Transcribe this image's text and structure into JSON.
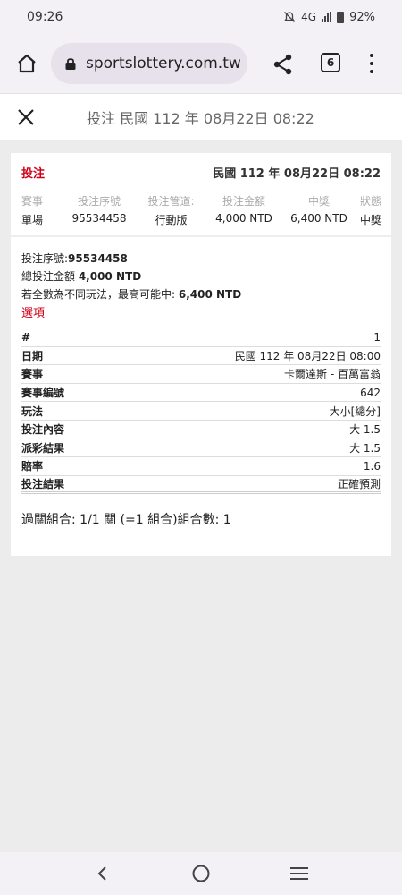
{
  "status": {
    "time": "09:26",
    "network": "4G",
    "battery": "92%"
  },
  "browser": {
    "url": "sportslottery.com.tw",
    "tab_count": "6"
  },
  "header": {
    "title": "投注 民國 112 年 08月22日 08:22"
  },
  "card": {
    "bet_label": "投注",
    "bet_date": "民國 112 年 08月22日 08:22",
    "headers": [
      "賽事",
      "投注序號",
      "投注管道:",
      "投注金額",
      "中獎",
      "狀態"
    ],
    "values": [
      "單場",
      "95534458",
      "行動版",
      "4,000 NTD",
      "6,400 NTD",
      "中獎"
    ],
    "serial_label": "投注序號:",
    "serial_value": "95534458",
    "total_label": "總投注金額 ",
    "total_value": "4,000 NTD",
    "max_label": "若全數為不同玩法，最高可能中: ",
    "max_value": "6,400 NTD",
    "options_label": "選項",
    "rows": [
      {
        "k": "#",
        "v": "1"
      },
      {
        "k": "日期",
        "v": "民國 112 年 08月22日 08:00"
      },
      {
        "k": "賽事",
        "v": "卡爾達斯 - 百萬富翁"
      },
      {
        "k": "賽事編號",
        "v": "642"
      },
      {
        "k": "玩法",
        "v": "大小[總分]"
      },
      {
        "k": "投注內容",
        "v": "大 1.5"
      },
      {
        "k": "派彩結果",
        "v": "大 1.5"
      },
      {
        "k": "賠率",
        "v": "1.6"
      },
      {
        "k": "投注結果",
        "v": "正確預測"
      }
    ],
    "combo": "過關組合: 1/1 關 (=1 組合)組合數: 1"
  }
}
